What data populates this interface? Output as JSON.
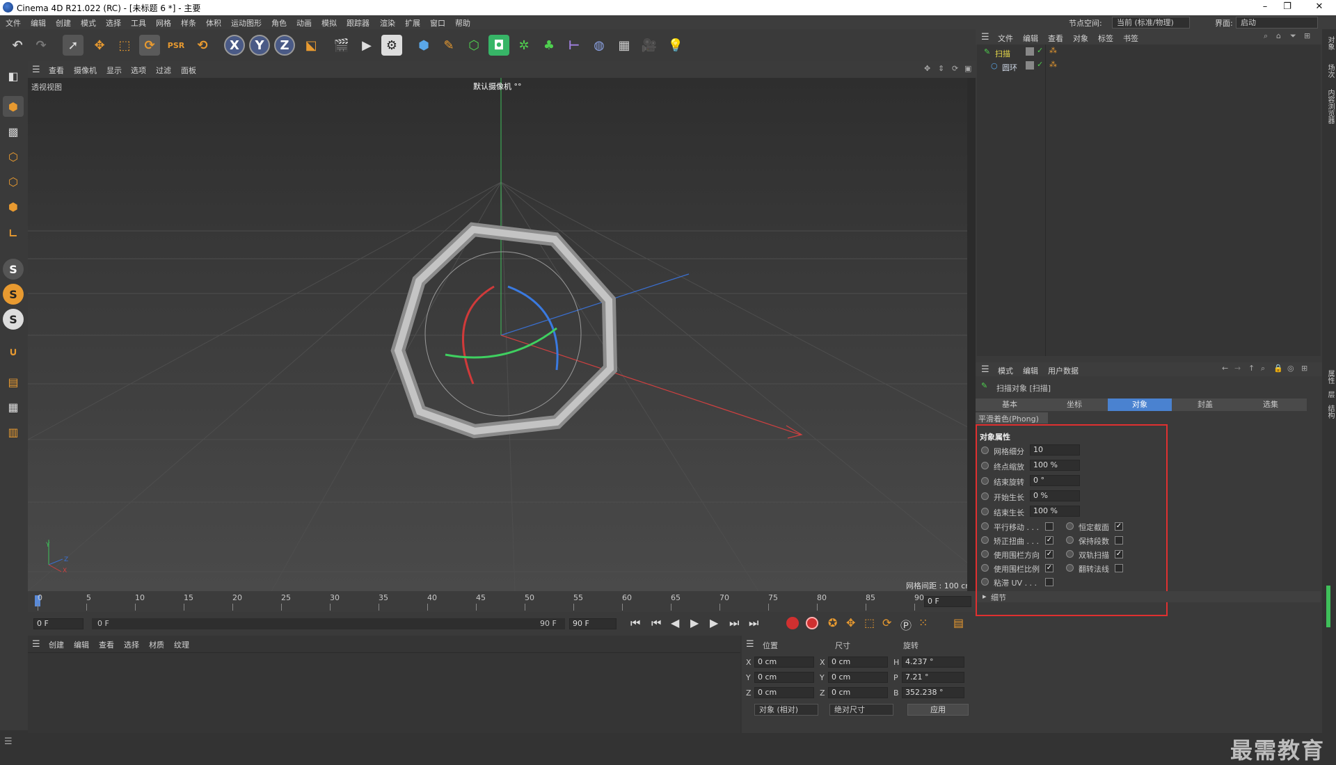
{
  "window": {
    "title": "Cinema 4D R21.022 (RC) - [未标题 6 *] - 主要",
    "min": "–",
    "max": "❐",
    "close": "✕"
  },
  "menubar": {
    "items": [
      "文件",
      "编辑",
      "创建",
      "模式",
      "选择",
      "工具",
      "网格",
      "样条",
      "体积",
      "运动图形",
      "角色",
      "动画",
      "模拟",
      "跟踪器",
      "渲染",
      "扩展",
      "窗口",
      "帮助"
    ],
    "node_space_label": "节点空间:",
    "node_space_value": "当前 (标准/物理)",
    "layout_label": "界面:",
    "layout_value": "启动"
  },
  "viewport": {
    "menu": [
      "查看",
      "摄像机",
      "显示",
      "选项",
      "过滤",
      "面板"
    ],
    "view_name": "透视视图",
    "camera_label": "默认摄像机 °°",
    "grid_spacing": "网格间距 : 100 cm",
    "axis_labels": {
      "y": "Y",
      "z": "Z",
      "x": "X"
    }
  },
  "timeline": {
    "ticks": [
      "0",
      "5",
      "10",
      "15",
      "20",
      "25",
      "30",
      "35",
      "40",
      "45",
      "50",
      "55",
      "60",
      "65",
      "70",
      "75",
      "80",
      "85",
      "90"
    ],
    "current_frame": "0 F"
  },
  "playbar": {
    "start": "0 F",
    "range_start": "0 F",
    "range_end": "90 F",
    "end": "90 F"
  },
  "material_manager": {
    "menu": [
      "创建",
      "编辑",
      "查看",
      "选择",
      "材质",
      "纹理"
    ]
  },
  "coord_manager": {
    "headers": [
      "位置",
      "尺寸",
      "旋转"
    ],
    "rows": [
      {
        "axis": "X",
        "pos": "0 cm",
        "size_axis": "X",
        "size": "0 cm",
        "rot_axis": "H",
        "rot": "4.237 °"
      },
      {
        "axis": "Y",
        "pos": "0 cm",
        "size_axis": "Y",
        "size": "0 cm",
        "rot_axis": "P",
        "rot": "7.21 °"
      },
      {
        "axis": "Z",
        "pos": "0 cm",
        "size_axis": "Z",
        "size": "0 cm",
        "rot_axis": "B",
        "rot": "352.238 °"
      }
    ],
    "mode_select": "对象 (相对)",
    "size_select": "绝对尺寸",
    "apply_label": "应用"
  },
  "object_manager": {
    "menu": [
      "文件",
      "编辑",
      "查看",
      "对象",
      "标签",
      "书签"
    ],
    "objects": [
      {
        "name": "扫描",
        "color": "#e6d84a",
        "icon": "sweep-icon"
      },
      {
        "name": "圆环",
        "color": "#cfd8e6",
        "icon": "circle-spline-icon"
      }
    ]
  },
  "attributes": {
    "menu": [
      "模式",
      "编辑",
      "用户数据"
    ],
    "object_title": "扫描对象 [扫描]",
    "tabs": [
      "基本",
      "坐标",
      "对象",
      "封盖",
      "选集"
    ],
    "active_tab": "对象",
    "phong": "平滑着色(Phong)",
    "section_title": "对象属性",
    "fields": [
      {
        "label": "网格细分",
        "value": "10"
      },
      {
        "label": "终点缩放",
        "value": "100 %"
      },
      {
        "label": "结束旋转",
        "value": "0 °"
      },
      {
        "label": "开始生长",
        "value": "0 %"
      },
      {
        "label": "结束生长",
        "value": "100 %"
      }
    ],
    "checks_left": [
      {
        "label": "平行移动 . . .",
        "checked": false
      },
      {
        "label": "矫正扭曲 . . .",
        "checked": true
      },
      {
        "label": "使用围栏方向",
        "checked": true
      },
      {
        "label": "使用围栏比例",
        "checked": true
      },
      {
        "label": "粘滞 UV . . .",
        "checked": false
      }
    ],
    "checks_right": [
      {
        "label": "恒定截面",
        "checked": true
      },
      {
        "label": "保持段数",
        "checked": false
      },
      {
        "label": "双轨扫描",
        "checked": true
      },
      {
        "label": "翻转法线",
        "checked": false
      }
    ],
    "details": "细节",
    "highlight_color": "#e03030"
  },
  "side_strip": {
    "top": "对象",
    "mid": "场次",
    "low": "内容浏览器",
    "attr": "属性",
    "layer": "层",
    "struct": "结构"
  },
  "watermark": "最需教育"
}
